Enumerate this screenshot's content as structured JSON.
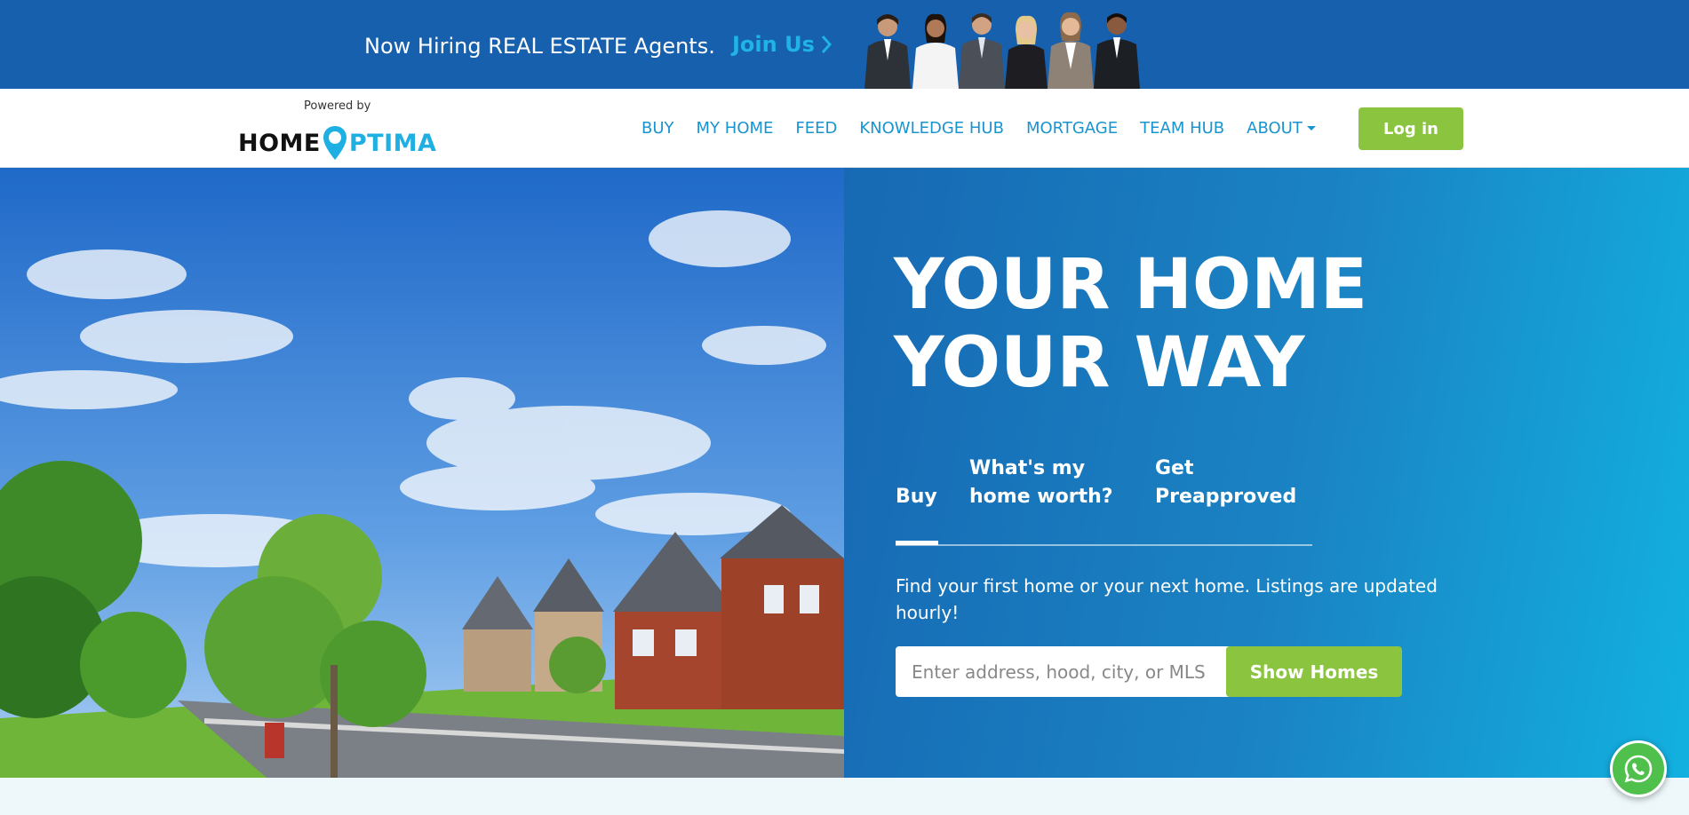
{
  "banner": {
    "text": "Now Hiring REAL ESTATE Agents.",
    "join_label": "Join Us",
    "join_icon": "chevron-right-icon"
  },
  "header": {
    "logo_powered": "Powered by",
    "logo_home": "HOME",
    "logo_optima": "PTIMA",
    "logo_pin_icon": "map-pin-icon",
    "nav": [
      {
        "label": "BUY"
      },
      {
        "label": "MY HOME"
      },
      {
        "label": "FEED"
      },
      {
        "label": "KNOWLEDGE HUB"
      },
      {
        "label": "MORTGAGE"
      },
      {
        "label": "TEAM HUB"
      },
      {
        "label": "ABOUT",
        "dropdown": true
      }
    ],
    "login_label": "Log in"
  },
  "hero": {
    "title_line1": "YOUR HOME",
    "title_line2": "YOUR WAY",
    "tabs": [
      {
        "label": "Buy",
        "active": true
      },
      {
        "label": "What's my home worth?"
      },
      {
        "label": "Get Preapproved"
      }
    ],
    "description": "Find your first home or your next home. Listings are updated hourly!",
    "search_placeholder": "Enter address, hood, city, or MLS",
    "search_button": "Show Homes"
  },
  "floating": {
    "whatsapp_icon": "whatsapp-icon"
  },
  "colors": {
    "banner_bg": "#1660ad",
    "accent_green": "#8bc43f",
    "nav_blue": "#1a94cf",
    "brand_cyan": "#1fb0e3"
  }
}
